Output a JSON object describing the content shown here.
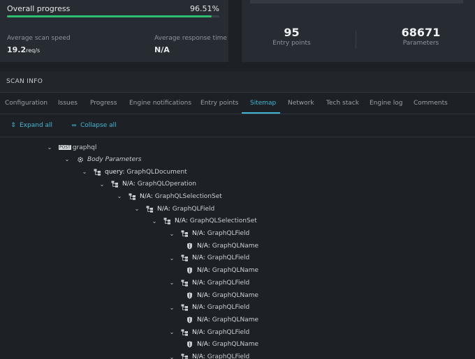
{
  "progress": {
    "label": "Overall progress",
    "percent": "96.51%",
    "fraction": 0.9651
  },
  "metrics": {
    "scan_speed_label": "Average scan speed",
    "scan_speed_value": "19.2",
    "scan_speed_unit": "req/s",
    "response_time_label": "Average response time",
    "response_time_value": "N/A"
  },
  "stats": {
    "entry_points_value": "95",
    "entry_points_label": "Entry points",
    "parameters_value": "68671",
    "parameters_label": "Parameters"
  },
  "section_title": "SCAN INFO",
  "tabs": [
    "Configuration",
    "Issues",
    "Progress",
    "Engine notifications",
    "Entry points",
    "Sitemap",
    "Network",
    "Tech stack",
    "Engine log",
    "Comments"
  ],
  "active_tab": "Sitemap",
  "toolbar": {
    "expand_all": "Expand all",
    "collapse_all": "Collapse all"
  },
  "tree": {
    "root": {
      "method": "POST",
      "label": "graphql"
    },
    "body_params": "Body Parameters",
    "nodes": [
      {
        "key": "query:",
        "type": "GraphQLDocument"
      },
      {
        "key": "N/A:",
        "type": "GraphQLOperation"
      },
      {
        "key": "N/A:",
        "type": "GraphQLSelectionSet"
      },
      {
        "key": "N/A:",
        "type": "GraphQLField"
      },
      {
        "key": "N/A:",
        "type": "GraphQLSelectionSet"
      },
      {
        "key": "N/A:",
        "type": "GraphQLField"
      },
      {
        "key": "N/A:",
        "type": "GraphQLName"
      },
      {
        "key": "N/A:",
        "type": "GraphQLField"
      },
      {
        "key": "N/A:",
        "type": "GraphQLName"
      },
      {
        "key": "N/A:",
        "type": "GraphQLField"
      },
      {
        "key": "N/A:",
        "type": "GraphQLName"
      },
      {
        "key": "N/A:",
        "type": "GraphQLField"
      },
      {
        "key": "N/A:",
        "type": "GraphQLName"
      },
      {
        "key": "N/A:",
        "type": "GraphQLField"
      },
      {
        "key": "N/A:",
        "type": "GraphQLName"
      },
      {
        "key": "N/A:",
        "type": "GraphQLField"
      }
    ]
  },
  "colors": {
    "accent": "#3fb8d6",
    "progress": "#2fbf71",
    "background": "#1d2126",
    "card": "#272c32"
  },
  "icons": [
    "post-method-icon",
    "gear-icon",
    "node-tree-icon",
    "shield-icon",
    "expand-icon",
    "collapse-icon",
    "chevron-down-icon"
  ]
}
